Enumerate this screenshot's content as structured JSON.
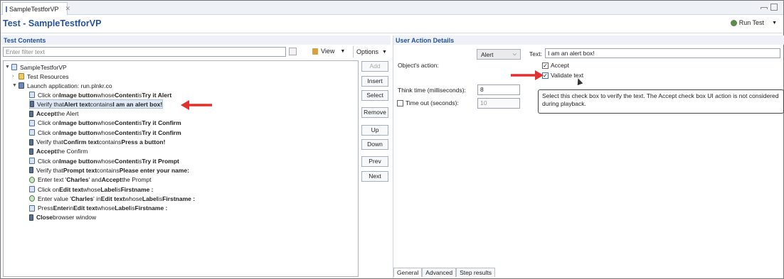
{
  "editor_tab": {
    "title": "SampleTestforVP",
    "close": "✕"
  },
  "test_header": {
    "title": "Test - SampleTestforVP",
    "run_label": "Run Test"
  },
  "test_contents": {
    "section_title": "Test Contents",
    "filter_placeholder": "Enter filter text",
    "view_label": "View",
    "options_label": "Options",
    "tree": {
      "root": "SampleTestforVP",
      "resources": "Test Resources",
      "launch": "Launch application: run.plnkr.co",
      "steps": [
        {
          "parts": [
            "Click on ",
            "Image button",
            " whose ",
            "Content",
            " is ",
            "Try it Alert"
          ]
        },
        {
          "parts": [
            "Verify that ",
            "Alert text",
            " contains ",
            "I am an alert box!"
          ],
          "selected": true
        },
        {
          "parts": [
            "",
            "Accept",
            " the Alert"
          ]
        },
        {
          "parts": [
            "Click on ",
            "Image button",
            " whose ",
            "Content",
            " is ",
            "Try it Confirm"
          ]
        },
        {
          "parts": [
            "Click on ",
            "Image button",
            " whose ",
            "Content",
            " is ",
            "Try it Confirm"
          ]
        },
        {
          "parts": [
            "Verify that ",
            "Confirm text",
            " contains ",
            "Press a button!"
          ]
        },
        {
          "parts": [
            "",
            "Accept",
            " the Confirm"
          ]
        },
        {
          "parts": [
            "Click on ",
            "Image button",
            " whose ",
            "Content",
            " is ",
            "Try it Prompt"
          ]
        },
        {
          "parts": [
            "Verify that ",
            "Prompt text",
            " contains ",
            "Please enter your name:"
          ]
        },
        {
          "parts": [
            "Enter text '",
            "Charles",
            "' and ",
            "Accept",
            " the Prompt"
          ]
        },
        {
          "parts": [
            "Click on ",
            "Edit text",
            " whose ",
            "Label",
            " is ",
            "Firstname :"
          ]
        },
        {
          "parts": [
            "Enter value '",
            "Charles",
            "' in ",
            "Edit text",
            " whose ",
            "Label",
            " is ",
            "Firstname :"
          ]
        },
        {
          "parts": [
            "Press ",
            "Enter",
            " in ",
            "Edit text",
            " whose ",
            "Label",
            " is ",
            "Firstname :"
          ]
        },
        {
          "parts": [
            "",
            "Close",
            " browser window"
          ]
        }
      ]
    },
    "buttons": {
      "add": "Add",
      "insert": "Insert",
      "select": "Select",
      "remove": "Remove",
      "up": "Up",
      "down": "Down",
      "prev": "Prev",
      "next": "Next"
    }
  },
  "user_action_details": {
    "section_title": "User Action Details",
    "object_type": "Alert",
    "text_label": "Text:",
    "text_value": "I am an alert box!",
    "object_action_label": "Object's action:",
    "accept_label": "Accept",
    "accept_checked": true,
    "validate_label": "Validate text",
    "validate_checked": true,
    "think_time_label": "Think time (milliseconds):",
    "think_time_value": "8",
    "timeout_label": "Time out (seconds):",
    "timeout_checked": false,
    "timeout_value": "10",
    "tooltip": "Select this check box to verify the text. The Accept check box UI action is not considered during playback.",
    "bottom_tabs": [
      "General",
      "Advanced",
      "Step results"
    ]
  },
  "colors": {
    "title_blue": "#26519b",
    "arrow_red": "#e0312f"
  }
}
